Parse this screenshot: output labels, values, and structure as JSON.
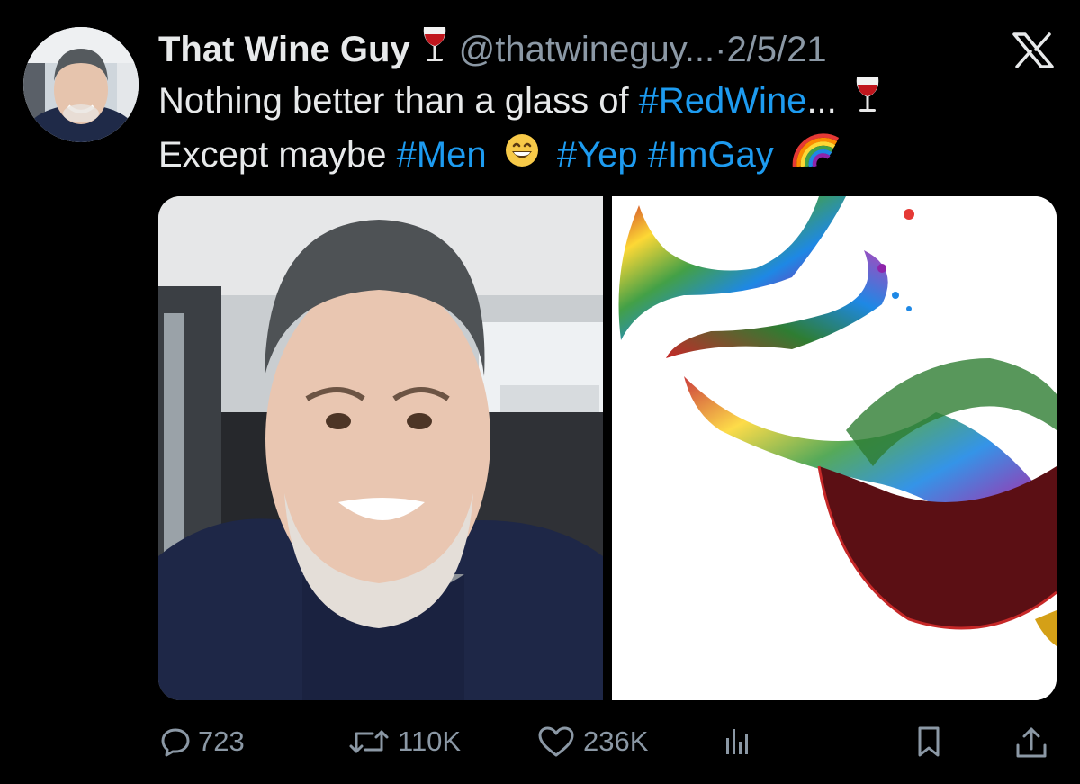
{
  "tweet": {
    "author": {
      "display_name": "That Wine Guy",
      "name_emoji": "wine-glass-icon",
      "handle": "@thatwineguy...",
      "separator": " · ",
      "date": "2/5/21"
    },
    "text": {
      "line1": [
        {
          "type": "text",
          "value": "Nothing better than a glass of "
        },
        {
          "type": "hashtag",
          "value": "#RedWine"
        },
        {
          "type": "text",
          "value": "..."
        }
      ],
      "line1_emoji": "wine-glass-icon",
      "line2_before": "Except maybe ",
      "hashtag_men": "#Men",
      "line2_emoji": "grinning-face-icon",
      "hashtag_yep": "#Yep",
      "hashtag_imgay": "#ImGay",
      "line2_end_emoji": "rainbow-icon"
    },
    "media": [
      {
        "kind": "photo",
        "icon": "selfie-photo"
      },
      {
        "kind": "photo",
        "icon": "rainbow-wine-splash-photo"
      }
    ],
    "actions": {
      "replies": "723",
      "retweets": "110K",
      "likes": "236K",
      "views_icon": "views-icon",
      "bookmark_icon": "bookmark-icon",
      "share_icon": "share-icon"
    },
    "colors": {
      "background": "#000000",
      "text": "#e7e9ea",
      "secondary": "#8b98a5",
      "link": "#1d9bf0"
    }
  }
}
